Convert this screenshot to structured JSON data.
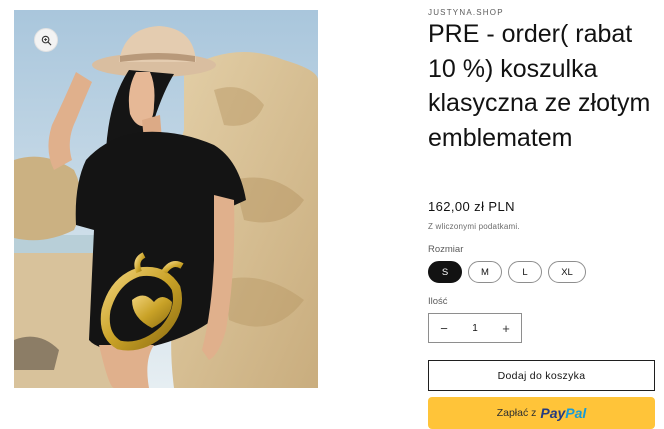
{
  "media": {
    "alt": "Model in black t-shirt with golden emblem and straw hat",
    "zoom_icon": "zoom-in-icon"
  },
  "product": {
    "vendor": "JUSTYNA.SHOP",
    "title": "PRE - order( rabat 10 %) koszulka klasyczna ze złotym emblematem",
    "price": "162,00 zł PLN",
    "tax_note": "Z wliczonymi podatkami."
  },
  "size": {
    "label": "Rozmiar",
    "options": [
      "S",
      "M",
      "L",
      "XL"
    ],
    "selected": "S"
  },
  "quantity": {
    "label": "Ilość",
    "value": "1",
    "minus": "−",
    "plus": "+"
  },
  "buttons": {
    "add_to_cart": "Dodaj do koszyka",
    "paypal_prefix": "Zapłać z",
    "paypal_pay": "Pay",
    "paypal_pal": "Pal"
  },
  "colors": {
    "accent": "#121212",
    "paypal_bg": "#ffc439",
    "gold": "#c9a227"
  }
}
